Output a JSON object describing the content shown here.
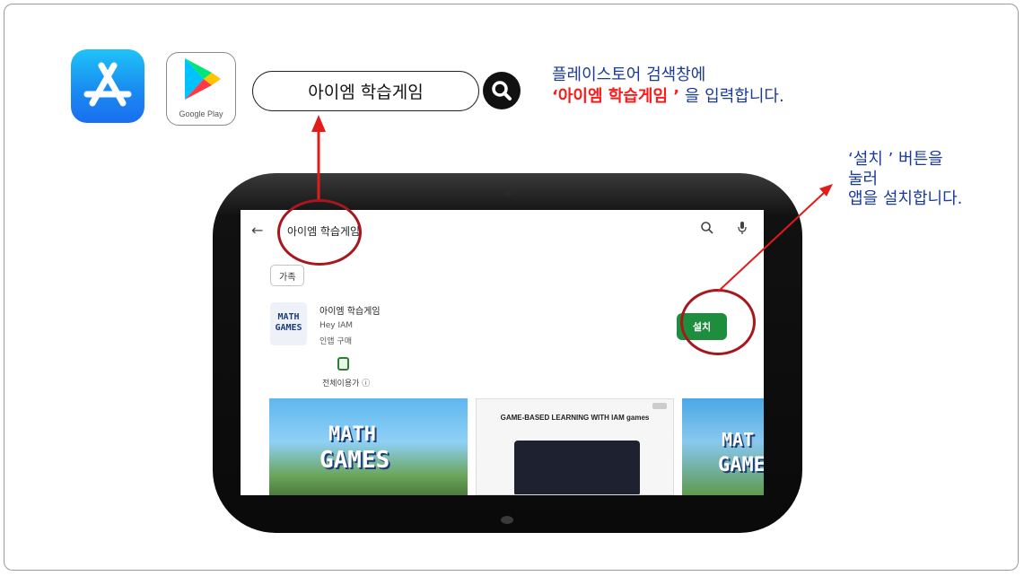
{
  "search_bar": {
    "query": "아이엠 학습게임"
  },
  "instruction_search": {
    "line1": "플레이스토어 검색창에",
    "highlight": "‘아이엠 학습게임 ’",
    "line2_rest": " 을 입력합니다."
  },
  "instruction_install": {
    "line1": "‘설치 ’ 버튼을",
    "line2": "눌러",
    "line3": "앱을 설치합니다."
  },
  "stores": {
    "google_play_label": "Google Play"
  },
  "play_store": {
    "query": "아이엠 학습게임",
    "chip": "가족",
    "app": {
      "name": "아이엠 학습게임",
      "developer": "Hey IAM",
      "in_app_purchase": "인앱 구매",
      "icon_text_1": "MATH",
      "icon_text_2": "GAMES",
      "rating": "전체이용가 ⓘ"
    },
    "install_label": "설치",
    "screenshot_2_title": "GAME-BASED LEARNING WITH IAM games",
    "screenshot_1_logo_1": "MATH",
    "screenshot_1_logo_2": "GAMES",
    "screenshot_3_logo_1": "MAT",
    "screenshot_3_logo_2": "GAME"
  },
  "colors": {
    "instruction_text": "#1a3a9a",
    "highlight": "#ff1a1a",
    "callout_arrow": "#e21b1b",
    "ring": "#a8171d",
    "install_button": "#1e8e3e"
  }
}
